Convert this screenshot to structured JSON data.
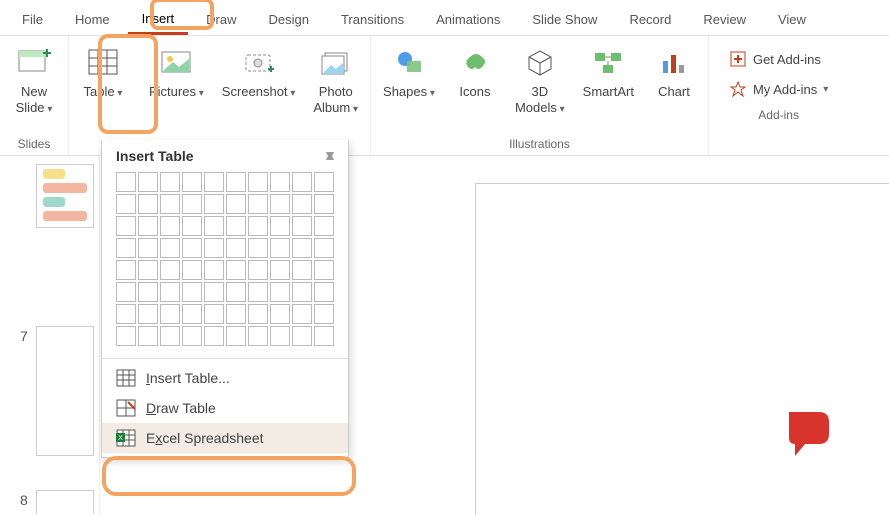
{
  "tabs": {
    "file": "File",
    "home": "Home",
    "insert": "Insert",
    "draw": "Draw",
    "design": "Design",
    "transitions": "Transitions",
    "animations": "Animations",
    "slideshow": "Slide Show",
    "record": "Record",
    "review": "Review",
    "view": "View"
  },
  "ribbon": {
    "slides_group": "Slides",
    "illustrations_group": "Illustrations",
    "addins_group": "Add-ins",
    "new_slide": "New\nSlide",
    "table": "Table",
    "pictures": "Pictures",
    "screenshot": "Screenshot",
    "photo_album": "Photo\nAlbum",
    "shapes": "Shapes",
    "icons": "Icons",
    "models": "3D\nModels",
    "smartart": "SmartArt",
    "chart": "Chart",
    "get_addins": "Get Add-ins",
    "my_addins": "My Add-ins"
  },
  "dropdown": {
    "header": "Insert Table",
    "insert_table": "Insert Table...",
    "draw_table": "Draw Table",
    "excel": "Excel Spreadsheet"
  },
  "slides": {
    "n7": "7",
    "n8": "8"
  }
}
